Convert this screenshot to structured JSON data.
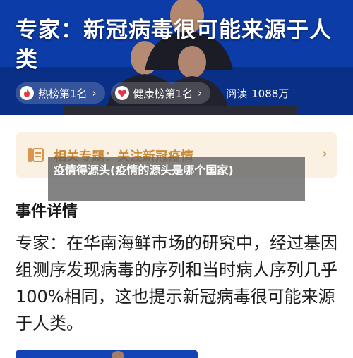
{
  "hero": {
    "title": "专家：新冠病毒很可能来源于人类"
  },
  "stats": {
    "hot_rank": "热榜第1名",
    "health_rank": "健康榜第1名",
    "reads_label": "阅读",
    "reads_value": "1088万"
  },
  "topic": {
    "text": "相关专题：关注新冠疫情"
  },
  "overlay": {
    "caption": "疫情得源头(疫情的源头是哪个国家)"
  },
  "section": {
    "title": "事件详情"
  },
  "article": {
    "body": "专家：在华南海鲜市场的研究中，经过基因组测序发现病毒的序列和当时病人序列几乎100%相同，这也提示新冠病毒很可能来源于人类。"
  },
  "colors": {
    "hero_bg": "#0d3fb0",
    "hot_red": "#e5393b",
    "health_red": "#e2374b",
    "topic_bg": "#fbf1e2",
    "topic_text": "#c98a3c"
  },
  "icons": {
    "hot": "flame-icon",
    "health": "heart-icon",
    "topic": "document-list-icon",
    "chevron": "chevron-right-icon"
  }
}
